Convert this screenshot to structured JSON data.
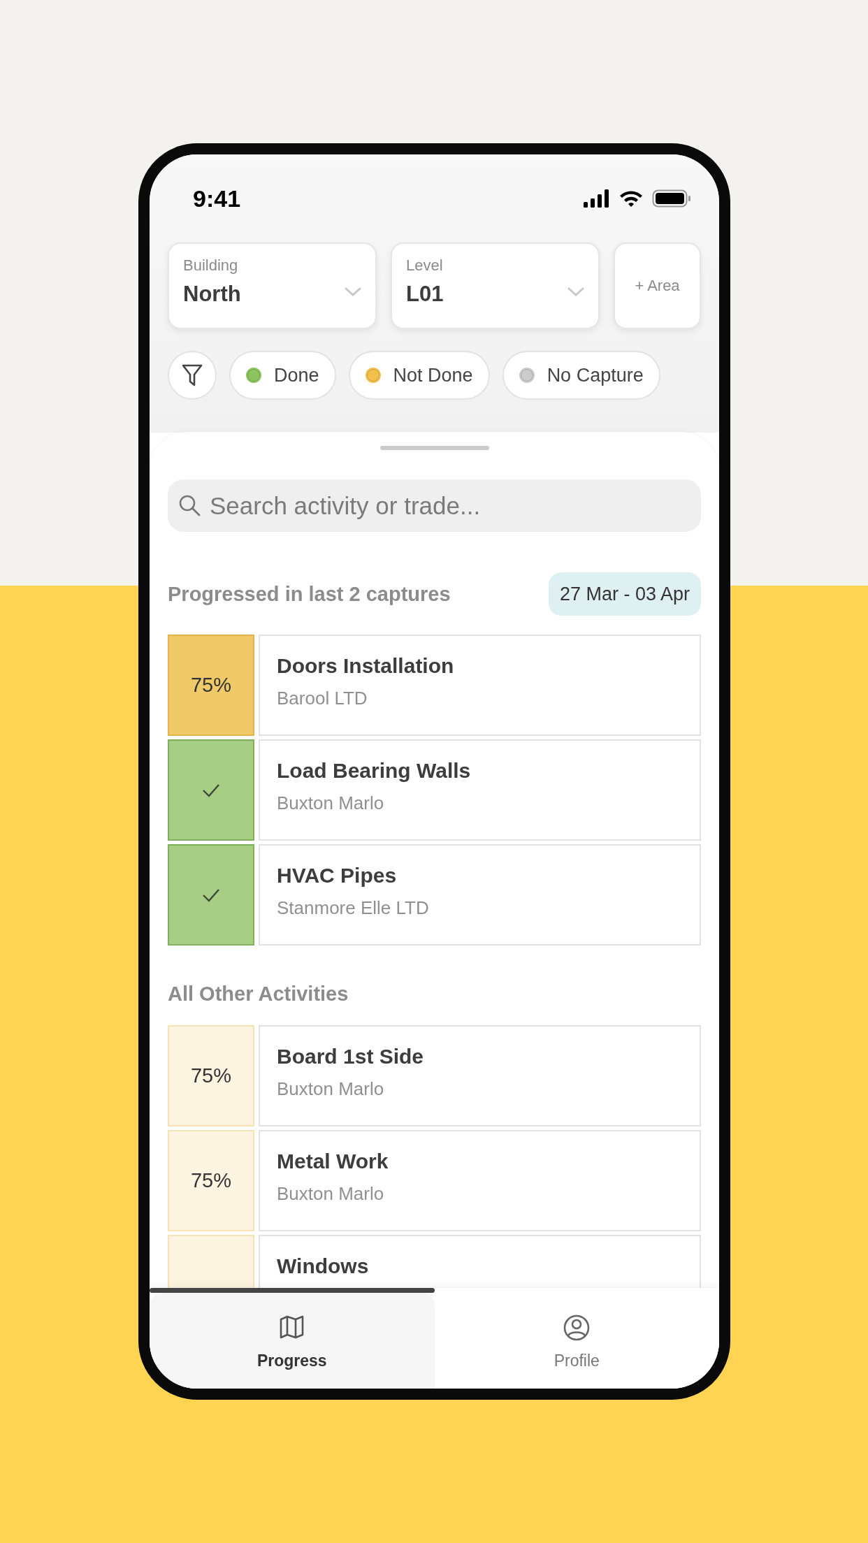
{
  "status_bar": {
    "time": "9:41"
  },
  "filters": {
    "dropdowns": [
      {
        "label": "Building",
        "value": "North"
      },
      {
        "label": "Level",
        "value": "L01"
      }
    ],
    "add_area": "+ Area"
  },
  "legend": [
    {
      "label": "Done",
      "color": "#8cc460"
    },
    {
      "label": "Not Done",
      "color": "#f2c04c"
    },
    {
      "label": "No Capture",
      "color": "#cccccc"
    }
  ],
  "search": {
    "placeholder": "Search activity or trade..."
  },
  "sections": [
    {
      "title": "Progressed in last 2 captures",
      "kind": "recent",
      "date_range": "27 Mar - 03 Apr",
      "rows": [
        {
          "title": "Doors Installation",
          "trade": "Barool LTD",
          "kind": "partial",
          "percent": "75%"
        },
        {
          "title": "Load Bearing Walls",
          "trade": "Buxton Marlo",
          "kind": "done"
        },
        {
          "title": "HVAC Pipes",
          "trade": "Stanmore Elle LTD",
          "kind": "done"
        }
      ]
    },
    {
      "title": "All Other Activities",
      "kind": "other",
      "rows": [
        {
          "title": "Board 1st Side",
          "trade": "Buxton Marlo",
          "kind": "partial",
          "percent": "75%"
        },
        {
          "title": "Metal Work",
          "trade": "Buxton Marlo",
          "kind": "partial",
          "percent": "75%"
        },
        {
          "title": "Windows",
          "kind": "partial"
        }
      ]
    }
  ],
  "tabs": [
    {
      "label": "Progress",
      "selected": true
    },
    {
      "label": "Profile",
      "selected": false
    }
  ]
}
